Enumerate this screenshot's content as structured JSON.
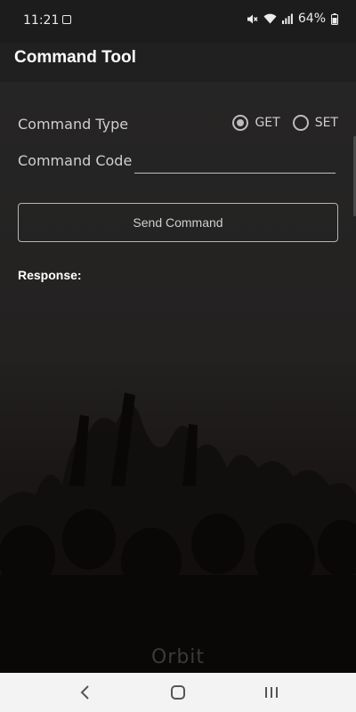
{
  "status_bar": {
    "time": "11:21",
    "battery_percent": "64%"
  },
  "app_bar": {
    "title": "Command Tool"
  },
  "form": {
    "command_type_label": "Command Type",
    "command_type_options": [
      "GET",
      "SET"
    ],
    "command_type_selected": "GET",
    "command_code_label": "Command Code",
    "command_code_value": "",
    "send_button_label": "Send Command",
    "response_label": "Response:"
  },
  "background": {
    "watermark_text": "Orbit"
  },
  "icons": {
    "status_left": [
      "notification-icon"
    ],
    "status_right": [
      "mute-icon",
      "wifi-icon",
      "signal-icon",
      "battery-icon"
    ],
    "nav": [
      "back-icon",
      "home-icon",
      "recents-icon"
    ]
  },
  "colors": {
    "status_bar_bg": "#1c1c1c",
    "app_bar_bg": "#202020",
    "content_bg": "#262525",
    "nav_bar_bg": "#f3f3f3",
    "text_primary": "#ffffff",
    "text_secondary": "#cfcfcf"
  }
}
